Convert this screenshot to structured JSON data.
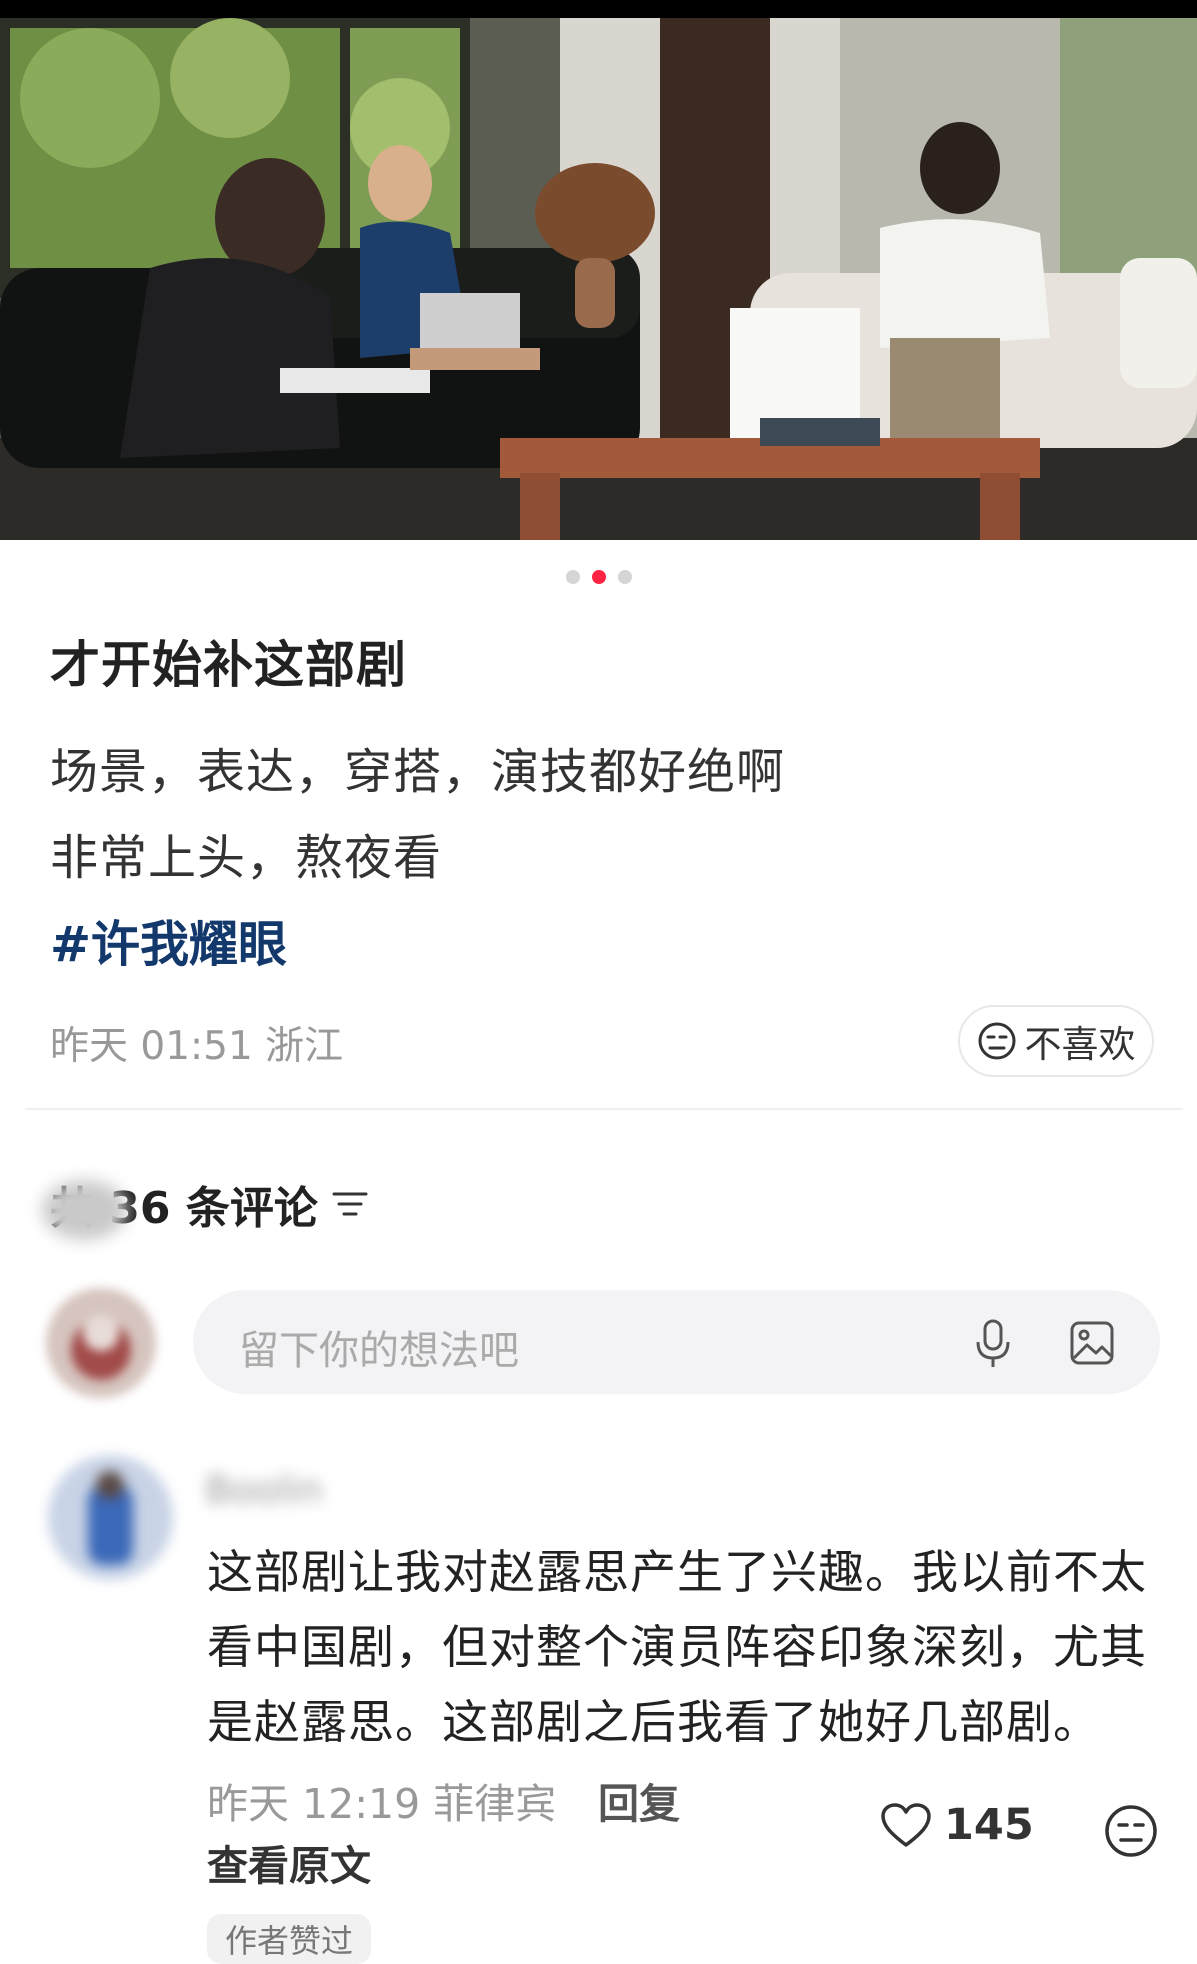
{
  "carousel": {
    "total": 3,
    "active_index": 1
  },
  "post": {
    "title": "才开始补这部剧",
    "body_line1": "场景，表达，穿搭，演技都好绝啊",
    "body_line2": "非常上头，熬夜看",
    "hashtag": "#许我耀眼",
    "meta": "昨天 01:51 浙江",
    "dislike_label": "不喜欢"
  },
  "comments": {
    "header": "共 36 条评论",
    "input_placeholder": "留下你的想法吧",
    "items": [
      {
        "username": "Boolin",
        "text": "这部剧让我对赵露思产生了兴趣。我以前不太看中国剧，但对整个演员阵容印象深刻，尤其是赵露思。这部剧之后我看了她好几部剧。",
        "meta": "昨天 12:19 菲律宾",
        "reply_label": "回复",
        "view_original": "查看原文",
        "likes": "145",
        "badge": "作者赞过"
      }
    ]
  },
  "icons": {
    "dislike": "neutral-face-icon",
    "sort": "sort-lines-icon",
    "mic": "microphone-icon",
    "image": "image-icon",
    "like": "heart-icon"
  },
  "colors": {
    "accent": "#ff2442",
    "hashtag": "#13386c",
    "muted": "#999999"
  }
}
